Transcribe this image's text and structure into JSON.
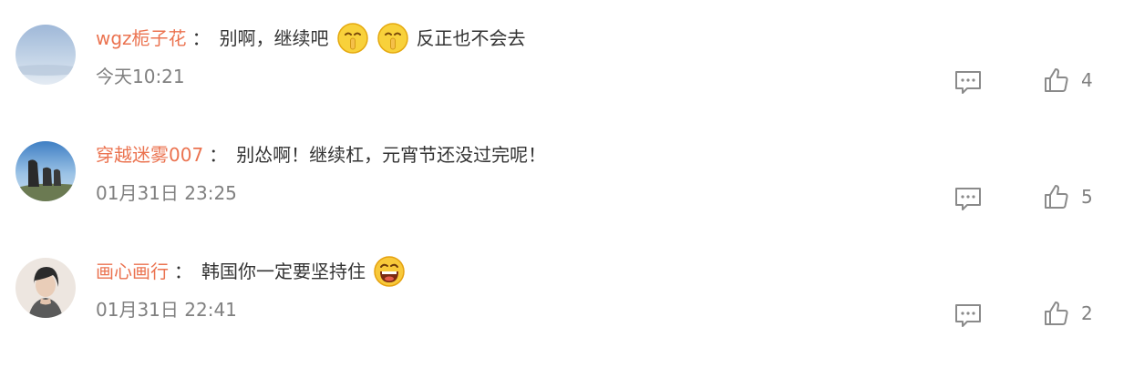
{
  "comments": [
    {
      "username": "wgz栀子花",
      "colon": "：",
      "text_before": "别啊，继续吧",
      "emoji_before": "shh-face",
      "emoji_after": "shh-face",
      "text_after": "反正也不会去",
      "time": "今天10:21",
      "likes": "4",
      "avatar": "sky-avatar"
    },
    {
      "username": "穿越迷雾007",
      "colon": "：",
      "text": "别怂啊！继续杠，元宵节还没过完呢！",
      "time": "01月31日 23:25",
      "likes": "5",
      "avatar": "hikers-avatar"
    },
    {
      "username": "画心画行",
      "colon": "：",
      "text": "韩国你一定要坚持住",
      "emoji": "laughing-face",
      "time": "01月31日 22:41",
      "likes": "2",
      "avatar": "portrait-avatar"
    }
  ],
  "colors": {
    "username": "#eb7350",
    "text": "#333333",
    "meta": "#808080",
    "icon": "#8a8a8a"
  }
}
